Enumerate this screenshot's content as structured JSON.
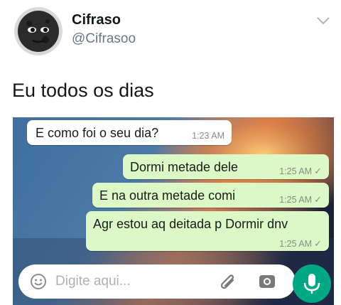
{
  "tweet": {
    "display_name": "Cifraso",
    "handle": "@Cifrasoo",
    "text": "Eu todos os dias",
    "avatar_icon": "moon-face-icon",
    "menu_icon": "chevron-down-icon"
  },
  "chat": {
    "messages": [
      {
        "direction": "incoming",
        "text": "E como foi o seu dia?",
        "time": "1:23 AM"
      },
      {
        "direction": "outgoing",
        "text": "Dormi metade dele",
        "time": "1:25 AM",
        "status": "sent"
      },
      {
        "direction": "outgoing",
        "text": "E na outra metade comi",
        "time": "1:25 AM",
        "status": "sent"
      },
      {
        "direction": "outgoing",
        "text": "Agr estou aq deitada p Dormir dnv",
        "time": "1:25 AM",
        "status": "sent"
      }
    ],
    "input": {
      "placeholder": "Digite aqui...",
      "emoji_icon": "emoji-icon",
      "attach_icon": "paperclip-icon",
      "camera_icon": "camera-icon",
      "mic_icon": "microphone-icon"
    },
    "colors": {
      "outgoing_bubble": "#dcf8c6",
      "incoming_bubble": "#ffffff",
      "mic_button": "#00a884"
    }
  }
}
